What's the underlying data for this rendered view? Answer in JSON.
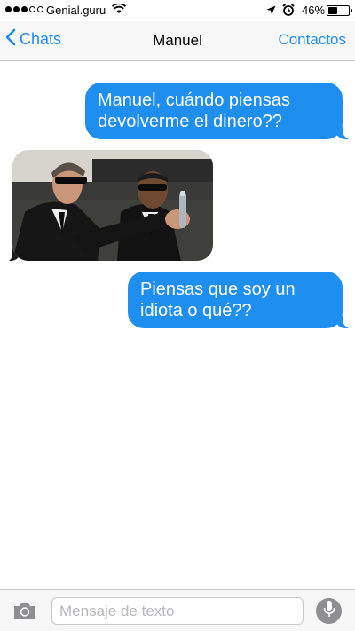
{
  "status_bar": {
    "carrier": "Genial.guru",
    "battery_percent": "46%",
    "battery_level": 0.46,
    "icons": [
      "signal-dots-icon",
      "wifi-icon",
      "location-arrow-icon",
      "alarm-clock-icon",
      "battery-icon"
    ]
  },
  "nav": {
    "back_label": "Chats",
    "title": "Manuel",
    "right_label": "Contactos"
  },
  "messages": [
    {
      "direction": "outgoing",
      "type": "text",
      "text": "Manuel, cuándo piensas devolverme el dinero??"
    },
    {
      "direction": "incoming",
      "type": "image",
      "image_description": "photo-two-men-in-black-suits"
    },
    {
      "direction": "outgoing",
      "type": "text",
      "text": "Piensas que soy un idiota o qué??"
    }
  ],
  "composer": {
    "placeholder": "Mensaje de texto",
    "value": "",
    "icons": [
      "camera-icon",
      "microphone-icon"
    ]
  },
  "colors": {
    "accent": "#1d8cf8",
    "outgoing_bubble": "#1f8ef1",
    "mic_button": "#8e8e93"
  }
}
